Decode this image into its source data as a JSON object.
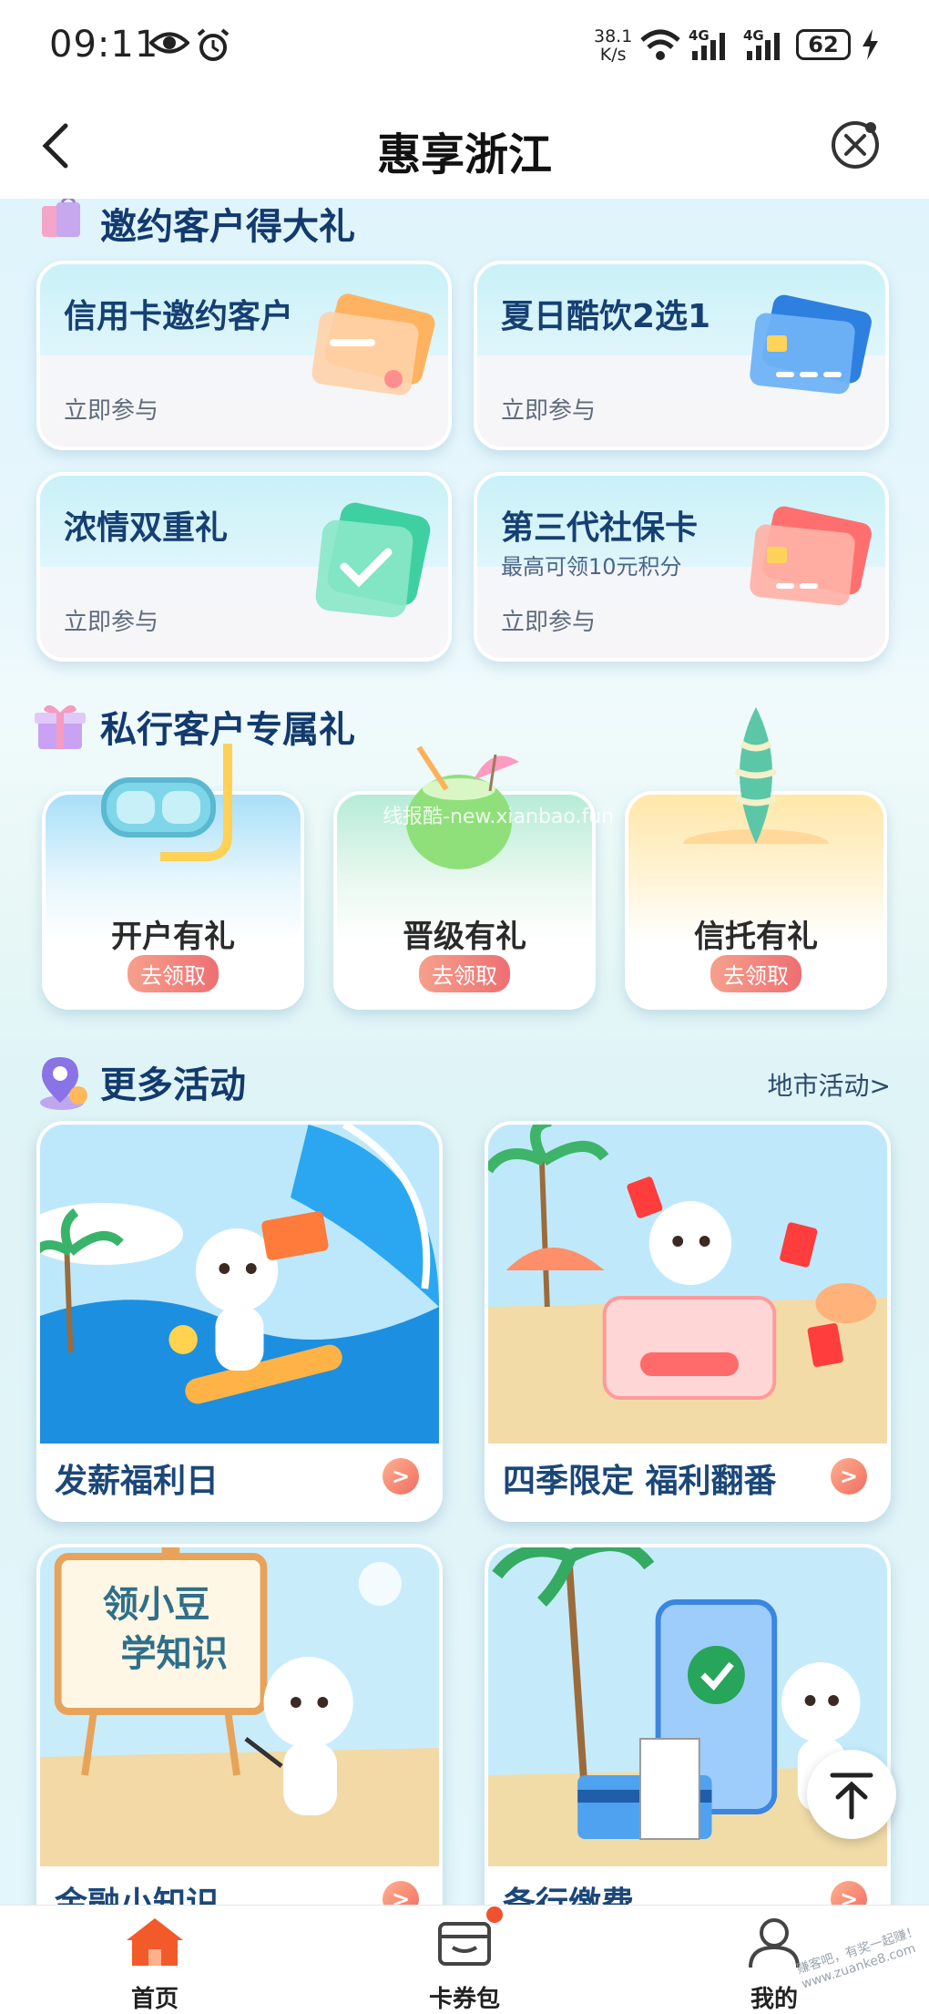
{
  "status_bar": {
    "time": "09:11",
    "speed_value": "38.1",
    "speed_unit": "K/s",
    "network1": "4G",
    "network2": "4G",
    "battery": "62"
  },
  "header": {
    "title": "惠享浙江"
  },
  "invite_section": {
    "title": "邀约客户得大礼",
    "cards": [
      {
        "title": "信用卡邀约客户",
        "subtitle": "",
        "cta": "立即参与"
      },
      {
        "title": "夏日酷饮2选1",
        "subtitle": "",
        "cta": "立即参与"
      },
      {
        "title": "浓情双重礼",
        "subtitle": "",
        "cta": "立即参与"
      },
      {
        "title": "第三代社保卡",
        "subtitle": "最高可领10元积分",
        "cta": "立即参与"
      }
    ]
  },
  "private_section": {
    "title": "私行客户专属礼",
    "cards": [
      {
        "title": "开户有礼",
        "badge": "去领取"
      },
      {
        "title": "晋级有礼",
        "badge": "去领取"
      },
      {
        "title": "信托有礼",
        "badge": "去领取"
      }
    ],
    "watermark": "线报酷-new.xianbao.fun"
  },
  "more_section": {
    "title": "更多活动",
    "link": "地市活动>",
    "cards": [
      {
        "label": "发薪福利日"
      },
      {
        "label": "四季限定 福利翻番"
      },
      {
        "label": "金融小知识",
        "board_line1": "领小豆",
        "board_line2": "学知识"
      },
      {
        "label": "备行缴费"
      }
    ]
  },
  "bottom_nav": {
    "items": [
      {
        "label": "首页"
      },
      {
        "label": "卡券包"
      },
      {
        "label": "我的"
      }
    ]
  },
  "corner_mark": "赚客吧，有奖一起赚！ www.zuanke8.com"
}
